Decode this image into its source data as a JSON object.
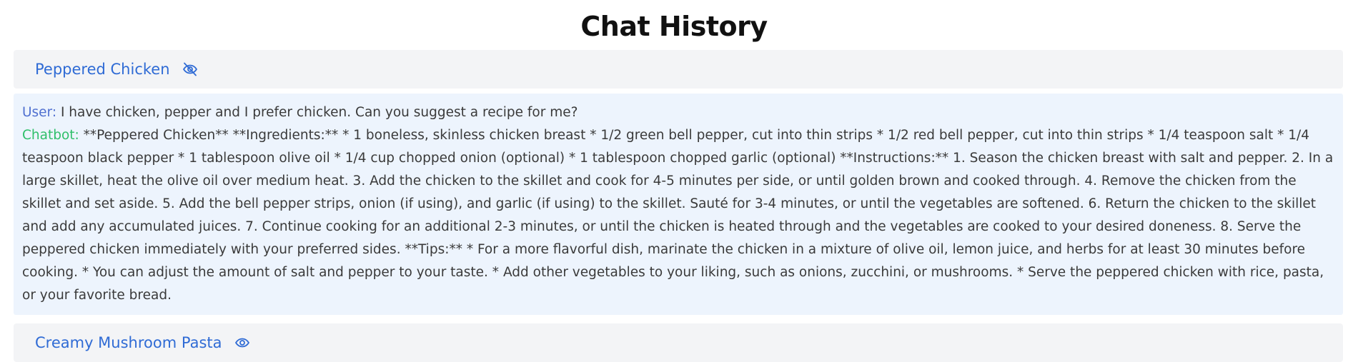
{
  "page": {
    "title": "Chat History"
  },
  "chats": [
    {
      "title": "Peppered Chicken",
      "icon": "eye-off-icon",
      "expanded": true,
      "messages": {
        "user_label": "User:",
        "user_text": " I have chicken, pepper and I prefer chicken. Can you suggest a recipe for me?",
        "bot_label": "Chatbot:",
        "bot_text": " **Peppered Chicken** **Ingredients:** * 1 boneless, skinless chicken breast * 1/2 green bell pepper, cut into thin strips * 1/2 red bell pepper, cut into thin strips * 1/4 teaspoon salt * 1/4 teaspoon black pepper * 1 tablespoon olive oil * 1/4 cup chopped onion (optional) * 1 tablespoon chopped garlic (optional) **Instructions:** 1. Season the chicken breast with salt and pepper. 2. In a large skillet, heat the olive oil over medium heat. 3. Add the chicken to the skillet and cook for 4-5 minutes per side, or until golden brown and cooked through. 4. Remove the chicken from the skillet and set aside. 5. Add the bell pepper strips, onion (if using), and garlic (if using) to the skillet. Sauté for 3-4 minutes, or until the vegetables are softened. 6. Return the chicken to the skillet and add any accumulated juices. 7. Continue cooking for an additional 2-3 minutes, or until the chicken is heated through and the vegetables are cooked to your desired doneness. 8. Serve the peppered chicken immediately with your preferred sides. **Tips:** * For a more flavorful dish, marinate the chicken in a mixture of olive oil, lemon juice, and herbs for at least 30 minutes before cooking. * You can adjust the amount of salt and pepper to your taste. * Add other vegetables to your liking, such as onions, zucchini, or mushrooms. * Serve the peppered chicken with rice, pasta, or your favorite bread."
      }
    },
    {
      "title": "Creamy Mushroom Pasta",
      "icon": "eye-icon",
      "expanded": false
    }
  ],
  "colors": {
    "title_link": "#2f6bd5",
    "user_label": "#4f6fd0",
    "bot_label": "#2fbf6a",
    "header_bg": "#f3f4f6",
    "body_bg": "#edf4fd"
  }
}
